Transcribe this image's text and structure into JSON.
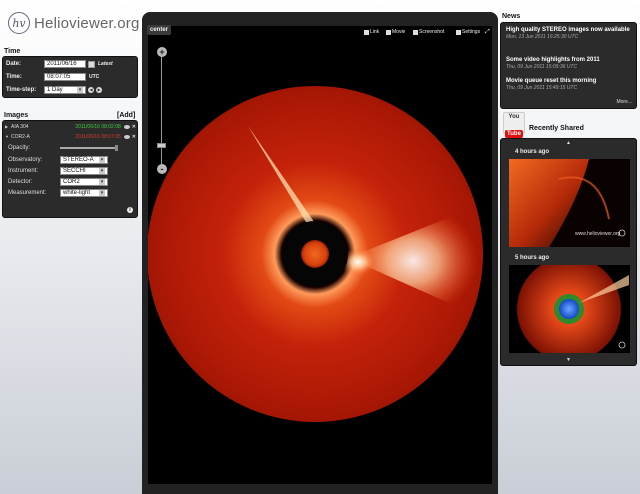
{
  "app": {
    "logo_mark": "hv",
    "logo_text": "Helioviewer.org"
  },
  "time": {
    "title": "Time",
    "date_label": "Date:",
    "date_value": "2011/06/16",
    "latest_label": "Latest",
    "time_label": "Time:",
    "time_value": "08:07:05",
    "tz": "UTC",
    "step_label": "Time-step:",
    "step_value": "1 Day"
  },
  "images": {
    "title": "Images",
    "add_label": "[Add]",
    "layers": [
      {
        "name": "AIA 304",
        "date": "2011/06/16 08:02:08",
        "color": "#3ec93e"
      },
      {
        "name": "COR2-A",
        "date": "2011/06/16 08:07:05",
        "color": "#d23c2c"
      }
    ],
    "props": {
      "opacity_label": "Opacity:",
      "observatory_label": "Observatory:",
      "observatory_value": "STEREO-A",
      "instrument_label": "Instrument:",
      "instrument_value": "SECCHI",
      "detector_label": "Detector:",
      "detector_value": "COR2",
      "measurement_label": "Measurement:",
      "measurement_value": "white-light"
    }
  },
  "viewport": {
    "center_label": "center",
    "toolbar": {
      "link": "Link",
      "movie": "Movie",
      "screenshot": "Screenshot",
      "settings": "Settings"
    },
    "zoom_in": "+",
    "zoom_out": "-"
  },
  "news": {
    "title": "News",
    "items": [
      {
        "title": "High quality STEREO images now available",
        "date": "Mon, 13 Jun 2011 16:25:30 UTC"
      },
      {
        "title": "Some video highlights from 2011",
        "date": "Thu, 09 Jun 2011 15:09:36 UTC"
      },
      {
        "title": "Movie queue reset this morning",
        "date": "Thu, 09 Jun 2011 15:49:15 UTC"
      }
    ],
    "more": "More..."
  },
  "youtube": {
    "you": "You",
    "tube": "Tube"
  },
  "shared": {
    "title": "Recently Shared",
    "videos": [
      {
        "age": "4 hours ago"
      },
      {
        "age": "5 hours ago"
      }
    ],
    "watermark": "www.helioviewer.org"
  },
  "colors": {
    "panel_bg": "#2b2b2b",
    "corona_red": "#c4220a",
    "sun_core": "#e0400c"
  }
}
